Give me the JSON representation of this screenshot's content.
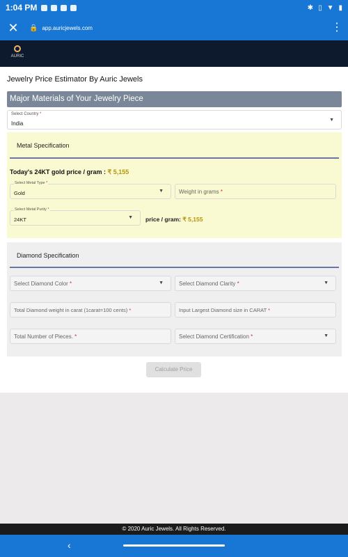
{
  "status_bar": {
    "time": "1:04 PM",
    "icons": [
      "youtube-icon",
      "battery-saver-icon",
      "cloud-icon",
      "phone-icon"
    ],
    "right_icons": [
      "bluetooth-icon",
      "vibrate-icon",
      "wifi-icon",
      "battery-icon"
    ]
  },
  "browser": {
    "url": "app.auricjewels.com",
    "close_glyph": "✕",
    "lock_glyph": "🔒",
    "menu_glyph": "⋮"
  },
  "site": {
    "logo_text": "AURIC"
  },
  "page": {
    "title": "Jewelry Price Estimator By Auric Jewels",
    "banner": "Major Materials of Your Jewelry Piece",
    "country": {
      "label": "Select Country",
      "required": "*",
      "value": "India"
    },
    "metal": {
      "heading": "Metal Specification",
      "gold_price_label": "Today's 24KT gold price / gram : ",
      "gold_price_value": "₹ 5,155",
      "type": {
        "label": "Select Metal Type",
        "required": "*",
        "value": "Gold"
      },
      "weight": {
        "placeholder": "Weight in grams",
        "required": "*"
      },
      "purity": {
        "label": "Select Metal Purity",
        "required": "*",
        "value": "24KT"
      },
      "price_per_gram_label": "price / gram: ",
      "price_per_gram_value": "₹ 5,155"
    },
    "diamond": {
      "heading": "Diamond Specification",
      "color": {
        "placeholder": "Select Diamond Color",
        "required": "*"
      },
      "clarity": {
        "placeholder": "Select Diamond Clarity",
        "required": "*"
      },
      "total_weight": {
        "placeholder": "Total Diamond weight in carat (1carat=100 cents)",
        "required": "*"
      },
      "largest_size": {
        "placeholder": "Input Largest Diamond size in CARAT",
        "required": "*"
      },
      "pieces": {
        "placeholder": "Total Number of Pieces.",
        "required": "*"
      },
      "certification": {
        "placeholder": "Select Diamond Certification",
        "required": "*"
      }
    },
    "calculate_label": "Calculate Price"
  },
  "footer": {
    "text": "©  2020 Auric Jewels. All Rights Reserved."
  },
  "navigation": {
    "back_glyph": "‹"
  }
}
